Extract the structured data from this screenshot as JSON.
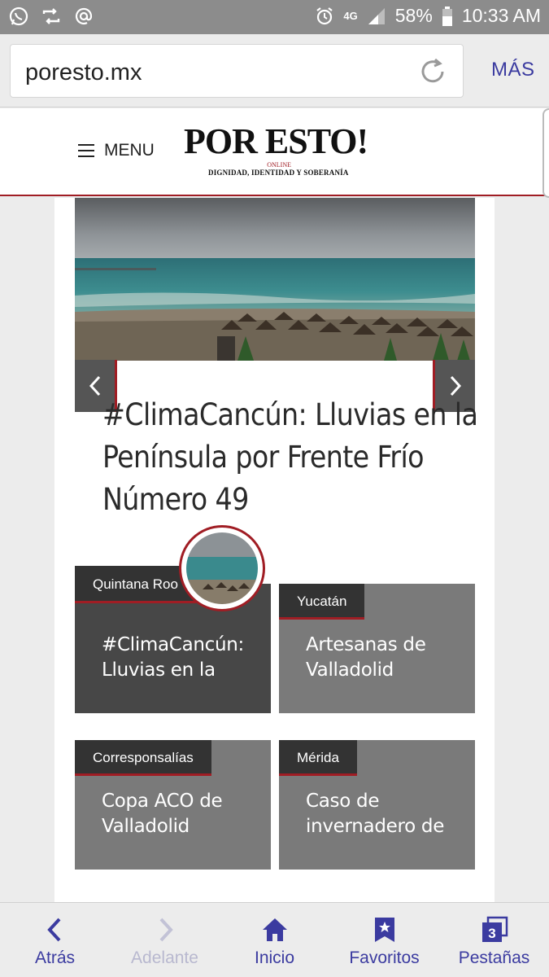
{
  "status_bar": {
    "battery": "58%",
    "time": "10:33 AM",
    "network": "4G"
  },
  "browser": {
    "url": "poresto.mx",
    "more_label": "MÁS"
  },
  "site": {
    "menu_label": "MENU",
    "logo_text": "POR ESTO!",
    "logo_online": "ONLINE",
    "logo_tagline": "DIGNIDAD, IDENTIDAD Y SOBERANÍA",
    "accent_color": "#a01d24"
  },
  "featured": {
    "headline": "#ClimaCancún: Lluvias en la Península por Frente Frío Número 49"
  },
  "cards": [
    {
      "category": "Quintana Roo",
      "title": "#ClimaCancún: Lluvias en la"
    },
    {
      "category": "Yucatán",
      "title": "Artesanas de Valladolid"
    },
    {
      "category": "Corresponsalías",
      "title": "Copa ACO de Valladolid"
    },
    {
      "category": "Mérida",
      "title": "Caso de invernadero de"
    }
  ],
  "bottom_nav": [
    {
      "label": "Atrás",
      "icon": "chevron-left-icon",
      "enabled": true
    },
    {
      "label": "Adelante",
      "icon": "chevron-right-icon",
      "enabled": false
    },
    {
      "label": "Inicio",
      "icon": "home-icon",
      "enabled": true
    },
    {
      "label": "Favoritos",
      "icon": "bookmark-star-icon",
      "enabled": true
    },
    {
      "label": "Pestañas",
      "icon": "tabs-icon",
      "enabled": true,
      "badge": "3"
    }
  ]
}
